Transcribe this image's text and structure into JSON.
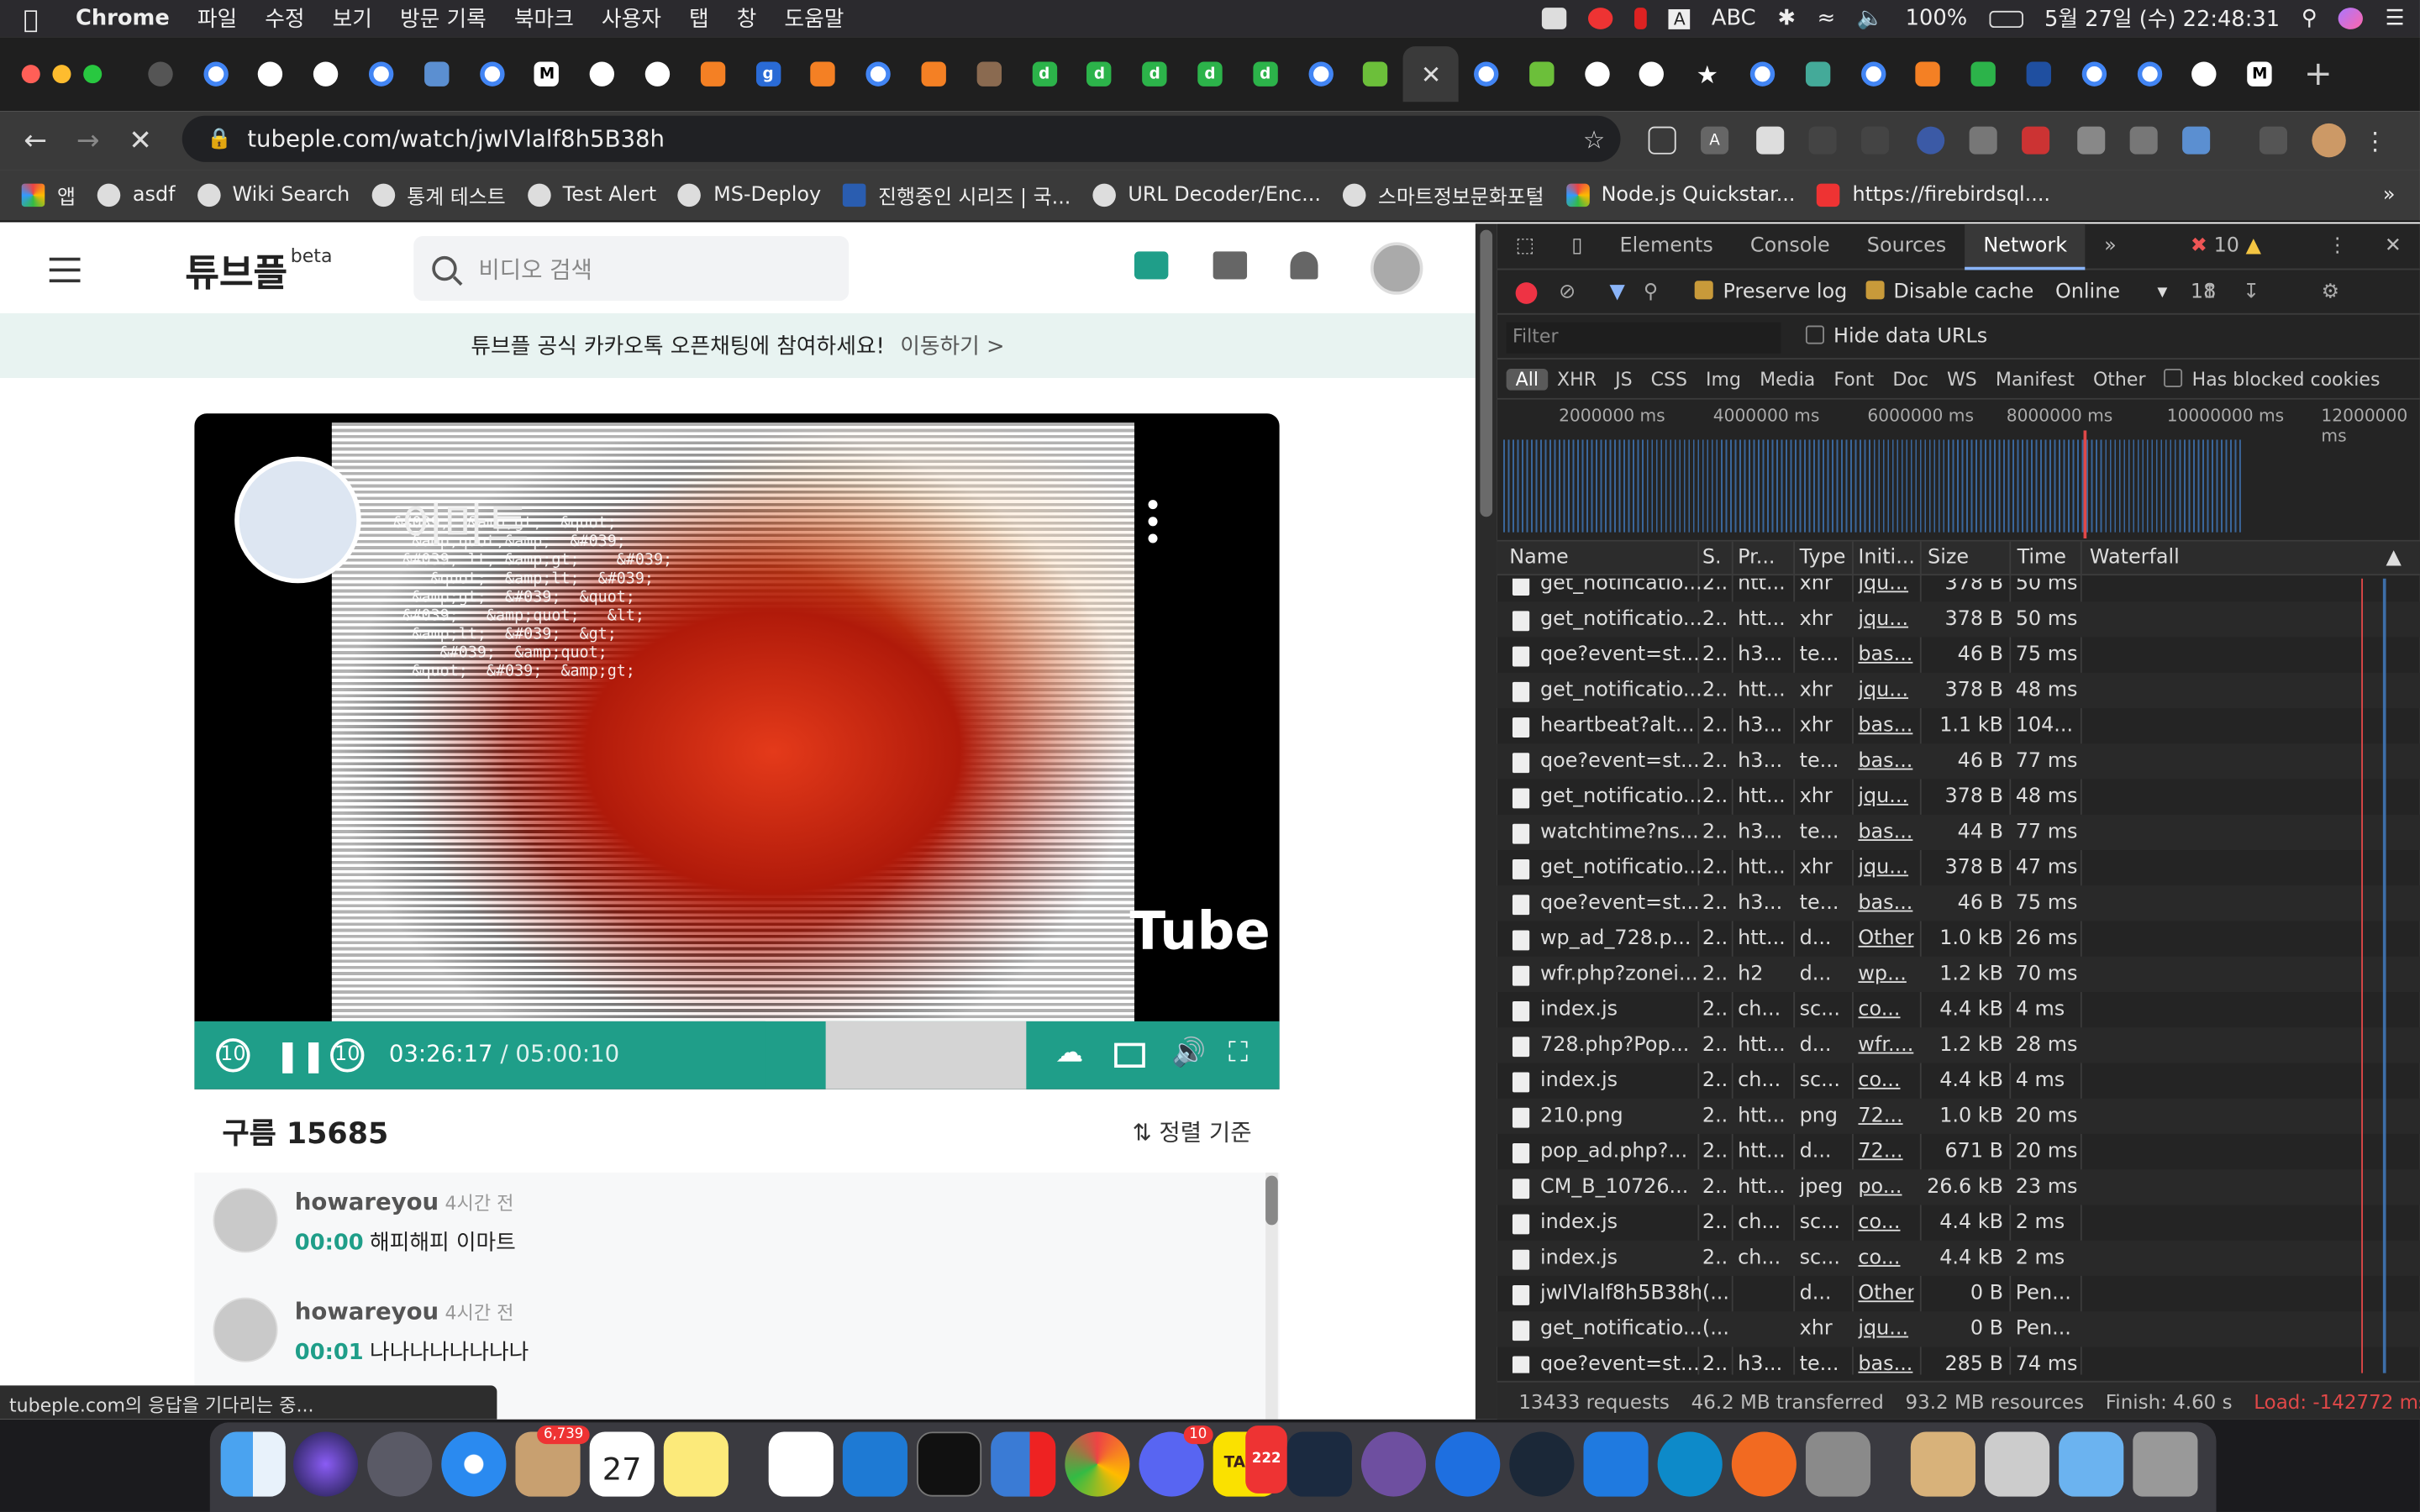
{
  "menubar": {
    "app": "Chrome",
    "items": [
      "파일",
      "수정",
      "보기",
      "방문 기록",
      "북마크",
      "사용자",
      "탭",
      "창",
      "도움말"
    ],
    "input_source": "ABC",
    "battery": "100%",
    "clock": "5월 27일 (수) 22:48:31"
  },
  "browser": {
    "url": "tubeple.com/watch/jwIVlalf8h5B38h",
    "bookmarks": [
      "앱",
      "asdf",
      "Wiki Search",
      "통계 테스트",
      "Test Alert",
      "MS-Deploy",
      "진행중인 시리즈 | 국...",
      "URL Decoder/Enc...",
      "스마트정보문화포털",
      "Node.js Quickstar...",
      "https://firebirdsql...."
    ]
  },
  "site": {
    "logo": "튜브플",
    "logo_badge": "beta",
    "search_placeholder": "비디오 검색",
    "notice": "튜브플 공식 카카오톡 오픈채팅에 참여하세요!",
    "notice_link": "이동하기 >",
    "channel_title": "이마트",
    "video_watermark": "Tube",
    "player": {
      "current_time": "03:26:17",
      "duration": "/ 05:00:10",
      "skip_back": "10",
      "skip_fwd": "10",
      "progress": 0.6866
    },
    "comments_title": "구름 15685",
    "sort_label": "정렬 기준",
    "comments": [
      {
        "user": "howareyou",
        "ago": "4시간 전",
        "ts": "00:00",
        "text": "해피해피 이마트"
      },
      {
        "user": "howareyou",
        "ago": "4시간 전",
        "ts": "00:01",
        "text": "나나나나나나나나"
      }
    ],
    "status_text": "tubeple.com의 응답을 기다리는 중..."
  },
  "devtools": {
    "tabs": [
      "Elements",
      "Console",
      "Sources",
      "Network"
    ],
    "errors": "10",
    "warnings": "18",
    "preserve_log": "Preserve log",
    "disable_cache": "Disable cache",
    "throttle": "Online",
    "filter_placeholder": "Filter",
    "hide_data_urls": "Hide data URLs",
    "types": [
      "All",
      "XHR",
      "JS",
      "CSS",
      "Img",
      "Media",
      "Font",
      "Doc",
      "WS",
      "Manifest",
      "Other"
    ],
    "blocked_cookies": "Has blocked cookies",
    "overview_ticks": [
      "2000000 ms",
      "4000000 ms",
      "6000000 ms",
      "8000000 ms",
      "10000000 ms",
      "12000000 ms"
    ],
    "columns": [
      "Name",
      "S.",
      "Pr...",
      "Type",
      "Initi...",
      "Size",
      "Time",
      "Waterfall"
    ],
    "rows": [
      [
        "get_notificatio...",
        "2..",
        "htt...",
        "xhr",
        "jqu...",
        "378 B",
        "50 ms"
      ],
      [
        "get_notificatio...",
        "2..",
        "htt...",
        "xhr",
        "jqu...",
        "378 B",
        "50 ms"
      ],
      [
        "qoe?event=st...",
        "2..",
        "h3...",
        "te...",
        "bas...",
        "46 B",
        "75 ms"
      ],
      [
        "get_notificatio...",
        "2..",
        "htt...",
        "xhr",
        "jqu...",
        "378 B",
        "48 ms"
      ],
      [
        "heartbeat?alt...",
        "2..",
        "h3...",
        "xhr",
        "bas...",
        "1.1 kB",
        "104..."
      ],
      [
        "qoe?event=st...",
        "2..",
        "h3...",
        "te...",
        "bas...",
        "46 B",
        "77 ms"
      ],
      [
        "get_notificatio...",
        "2..",
        "htt...",
        "xhr",
        "jqu...",
        "378 B",
        "48 ms"
      ],
      [
        "watchtime?ns...",
        "2..",
        "h3...",
        "te...",
        "bas...",
        "44 B",
        "77 ms"
      ],
      [
        "get_notificatio...",
        "2..",
        "htt...",
        "xhr",
        "jqu...",
        "378 B",
        "47 ms"
      ],
      [
        "qoe?event=st...",
        "2..",
        "h3...",
        "te...",
        "bas...",
        "46 B",
        "75 ms"
      ],
      [
        "wp_ad_728.p...",
        "2..",
        "htt...",
        "d...",
        "Other",
        "1.0 kB",
        "26 ms"
      ],
      [
        "wfr.php?zonei...",
        "2..",
        "h2",
        "d...",
        "wp...",
        "1.2 kB",
        "70 ms"
      ],
      [
        "index.js",
        "2..",
        "ch...",
        "sc...",
        "co...",
        "4.4 kB",
        "4 ms"
      ],
      [
        "728.php?Pop...",
        "2..",
        "htt...",
        "d...",
        "wfr....",
        "1.2 kB",
        "28 ms"
      ],
      [
        "index.js",
        "2..",
        "ch...",
        "sc...",
        "co...",
        "4.4 kB",
        "4 ms"
      ],
      [
        "210.png",
        "2..",
        "htt...",
        "png",
        "72...",
        "1.0 kB",
        "20 ms"
      ],
      [
        "pop_ad.php?...",
        "2..",
        "htt...",
        "d...",
        "72...",
        "671 B",
        "20 ms"
      ],
      [
        "CM_B_10726...",
        "2..",
        "htt...",
        "jpeg",
        "po...",
        "26.6 kB",
        "23 ms"
      ],
      [
        "index.js",
        "2..",
        "ch...",
        "sc...",
        "co...",
        "4.4 kB",
        "2 ms"
      ],
      [
        "index.js",
        "2..",
        "ch...",
        "sc...",
        "co...",
        "4.4 kB",
        "2 ms"
      ],
      [
        "jwIVlalf8h5B38h",
        "(...",
        "",
        "d...",
        "Other",
        "0 B",
        "Pen..."
      ],
      [
        "get_notificatio...",
        "(...",
        "",
        "xhr",
        "jqu...",
        "0 B",
        "Pen..."
      ],
      [
        "qoe?event=st...",
        "2..",
        "h3...",
        "te...",
        "bas...",
        "285 B",
        "74 ms"
      ]
    ],
    "status": {
      "requests": "13433 requests",
      "transferred": "46.2 MB transferred",
      "resources": "93.2 MB resources",
      "finish": "Finish: 4.60 s",
      "load": "Load: -142772 ms"
    }
  },
  "dock": {
    "badges": {
      "mail": "6,739",
      "calendar_day": "27",
      "discord": "10",
      "kakaotalk": "222"
    },
    "kakaotalk_label": "TALK"
  }
}
